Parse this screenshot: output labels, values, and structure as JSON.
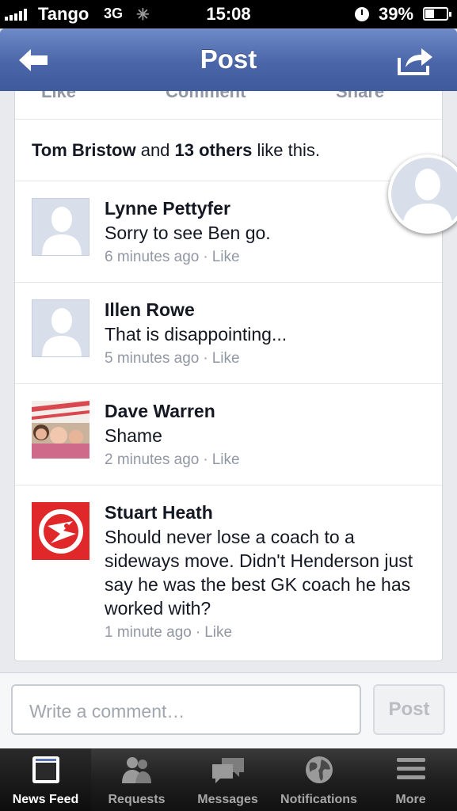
{
  "status_bar": {
    "carrier": "Tango",
    "network": "3G",
    "time": "15:08",
    "battery_percent": "39%"
  },
  "nav": {
    "title": "Post",
    "back_icon": "back-arrow-icon",
    "share_icon": "share-icon"
  },
  "post_actions": {
    "like": "Like",
    "comment": "Comment",
    "share": "Share"
  },
  "likes": {
    "name": "Tom Bristow",
    "mid": " and ",
    "others": "13 others",
    "suffix": " like this."
  },
  "comments": [
    {
      "author": "Lynne Pettyfer",
      "text": "Sorry to see Ben go.",
      "time": "6 minutes ago",
      "action": "Like",
      "avatar": "default-avatar"
    },
    {
      "author": "Illen Rowe",
      "text": "That is disappointing...",
      "time": "5 minutes ago",
      "action": "Like",
      "avatar": "default-avatar"
    },
    {
      "author": "Dave Warren",
      "text": "Shame",
      "time": "2 minutes ago",
      "action": "Like",
      "avatar": "photo-avatar"
    },
    {
      "author": "Stuart Heath",
      "text": "Should never lose a coach to a sideways move.  Didn't Henderson just say he was the best GK coach he has worked with?",
      "time": "1 minute ago",
      "action": "Like",
      "avatar": "hawks-logo-avatar"
    }
  ],
  "composer": {
    "placeholder": "Write a comment…",
    "post_label": "Post"
  },
  "tabs": [
    {
      "label": "News Feed",
      "icon": "news-feed-icon",
      "active": true
    },
    {
      "label": "Requests",
      "icon": "requests-icon",
      "active": false
    },
    {
      "label": "Messages",
      "icon": "messages-icon",
      "active": false
    },
    {
      "label": "Notifications",
      "icon": "globe-icon",
      "active": false
    },
    {
      "label": "More",
      "icon": "menu-icon",
      "active": false
    }
  ],
  "colors": {
    "nav_blue": "#4a66a8",
    "text": "#141823",
    "meta_grey": "#9197a3",
    "hawks_red": "#e0272a"
  }
}
